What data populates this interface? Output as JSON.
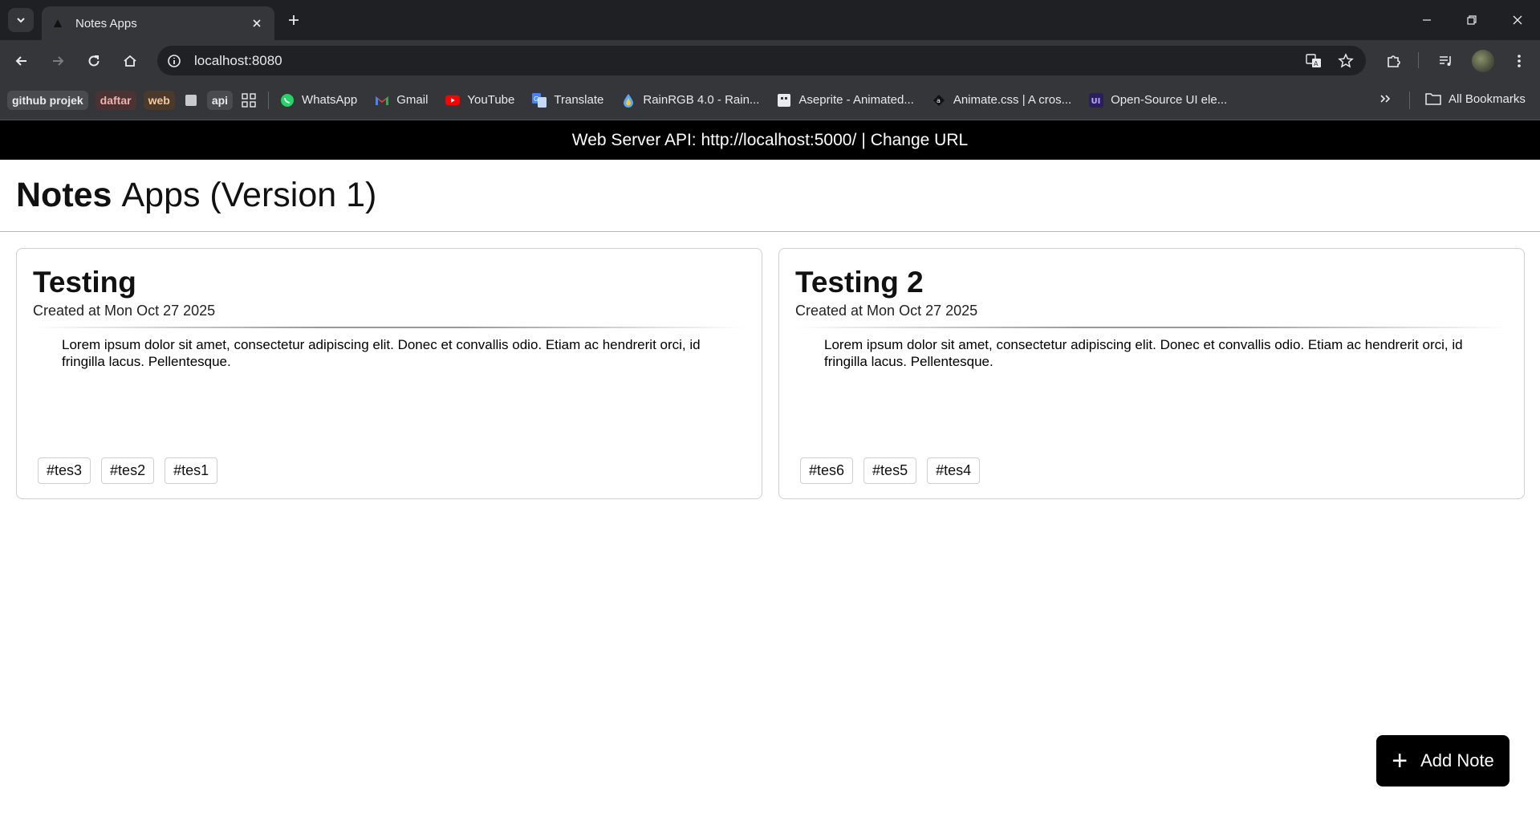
{
  "browser": {
    "tab_title": "Notes Apps",
    "url": "localhost:8080",
    "bookmarks": {
      "chips": [
        {
          "label": "github projek",
          "bg": "#4a4b4f",
          "color": "#e8eaed"
        },
        {
          "label": "daftar",
          "bg": "#4b3334",
          "color": "#f0b0b0"
        },
        {
          "label": "web",
          "bg": "#4b3a2c",
          "color": "#f2c8a0"
        },
        {
          "label": "",
          "bg": "#35363a",
          "color": "#e8eaed"
        },
        {
          "label": "api",
          "bg": "#4a4b4f",
          "color": "#e8eaed"
        }
      ],
      "links": [
        {
          "label": "WhatsApp",
          "icon": "whatsapp-icon"
        },
        {
          "label": "Gmail",
          "icon": "gmail-icon"
        },
        {
          "label": "YouTube",
          "icon": "youtube-icon"
        },
        {
          "label": "Translate",
          "icon": "translate-icon"
        },
        {
          "label": "RainRGB 4.0 - Rain...",
          "icon": "rainrgb-icon"
        },
        {
          "label": "Aseprite - Animated...",
          "icon": "aseprite-icon"
        },
        {
          "label": "Animate.css | A cros...",
          "icon": "animate-css-icon"
        },
        {
          "label": "Open-Source UI ele...",
          "icon": "ui-icon"
        }
      ],
      "all_bookmarks": "All Bookmarks"
    }
  },
  "page": {
    "api_prefix": "Web Server API:",
    "api_url": "http://localhost:5000/",
    "api_divider": "|",
    "change_url": "Change URL",
    "title_bold": "Notes",
    "title_rest": "Apps (Version 1)",
    "add_note": "Add Note"
  },
  "notes": [
    {
      "title": "Testing",
      "created": "Created at Mon Oct 27 2025",
      "body": "Lorem ipsum dolor sit amet, consectetur adipiscing elit. Donec et convallis odio. Etiam ac hendrerit orci, id fringilla lacus. Pellentesque.",
      "tags": [
        "#tes3",
        "#tes2",
        "#tes1"
      ]
    },
    {
      "title": "Testing 2",
      "created": "Created at Mon Oct 27 2025",
      "body": "Lorem ipsum dolor sit amet, consectetur adipiscing elit. Donec et convallis odio. Etiam ac hendrerit orci, id fringilla lacus. Pellentesque.",
      "tags": [
        "#tes6",
        "#tes5",
        "#tes4"
      ]
    }
  ]
}
